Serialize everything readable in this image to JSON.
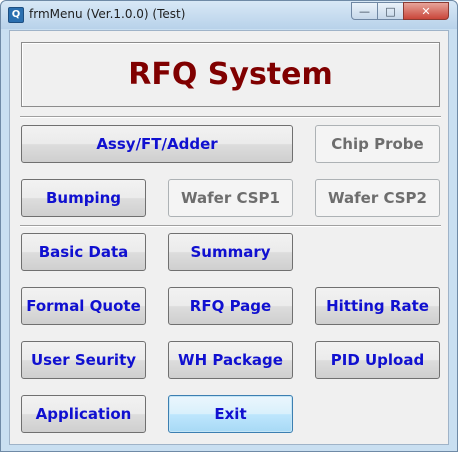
{
  "window": {
    "title": "frmMenu (Ver.1.0.0) (Test)",
    "icon_letter": "Q",
    "controls": {
      "minimize": "—",
      "maximize": "□",
      "close": "✕"
    }
  },
  "banner": {
    "title": "RFQ System"
  },
  "buttons": {
    "assy": "Assy/FT/Adder",
    "chip_probe": "Chip Probe",
    "bumping": "Bumping",
    "wafer_csp1": "Wafer CSP1",
    "wafer_csp2": "Wafer CSP2",
    "basic_data": "Basic Data",
    "summary": "Summary",
    "formal_quote": "Formal Quote",
    "rfq_page": "RFQ Page",
    "hitting_rate": "Hitting Rate",
    "user_security": "User Seurity",
    "wh_package": "WH Package",
    "pid_upload": "PID Upload",
    "application": "Application",
    "exit": "Exit"
  },
  "colors": {
    "title_color": "#800000",
    "button_text": "#1010d0",
    "disabled_text": "#6d6d6d"
  },
  "icons": {
    "app": "app-q-icon",
    "minimize": "minimize-icon",
    "maximize": "maximize-icon",
    "close": "close-icon"
  }
}
